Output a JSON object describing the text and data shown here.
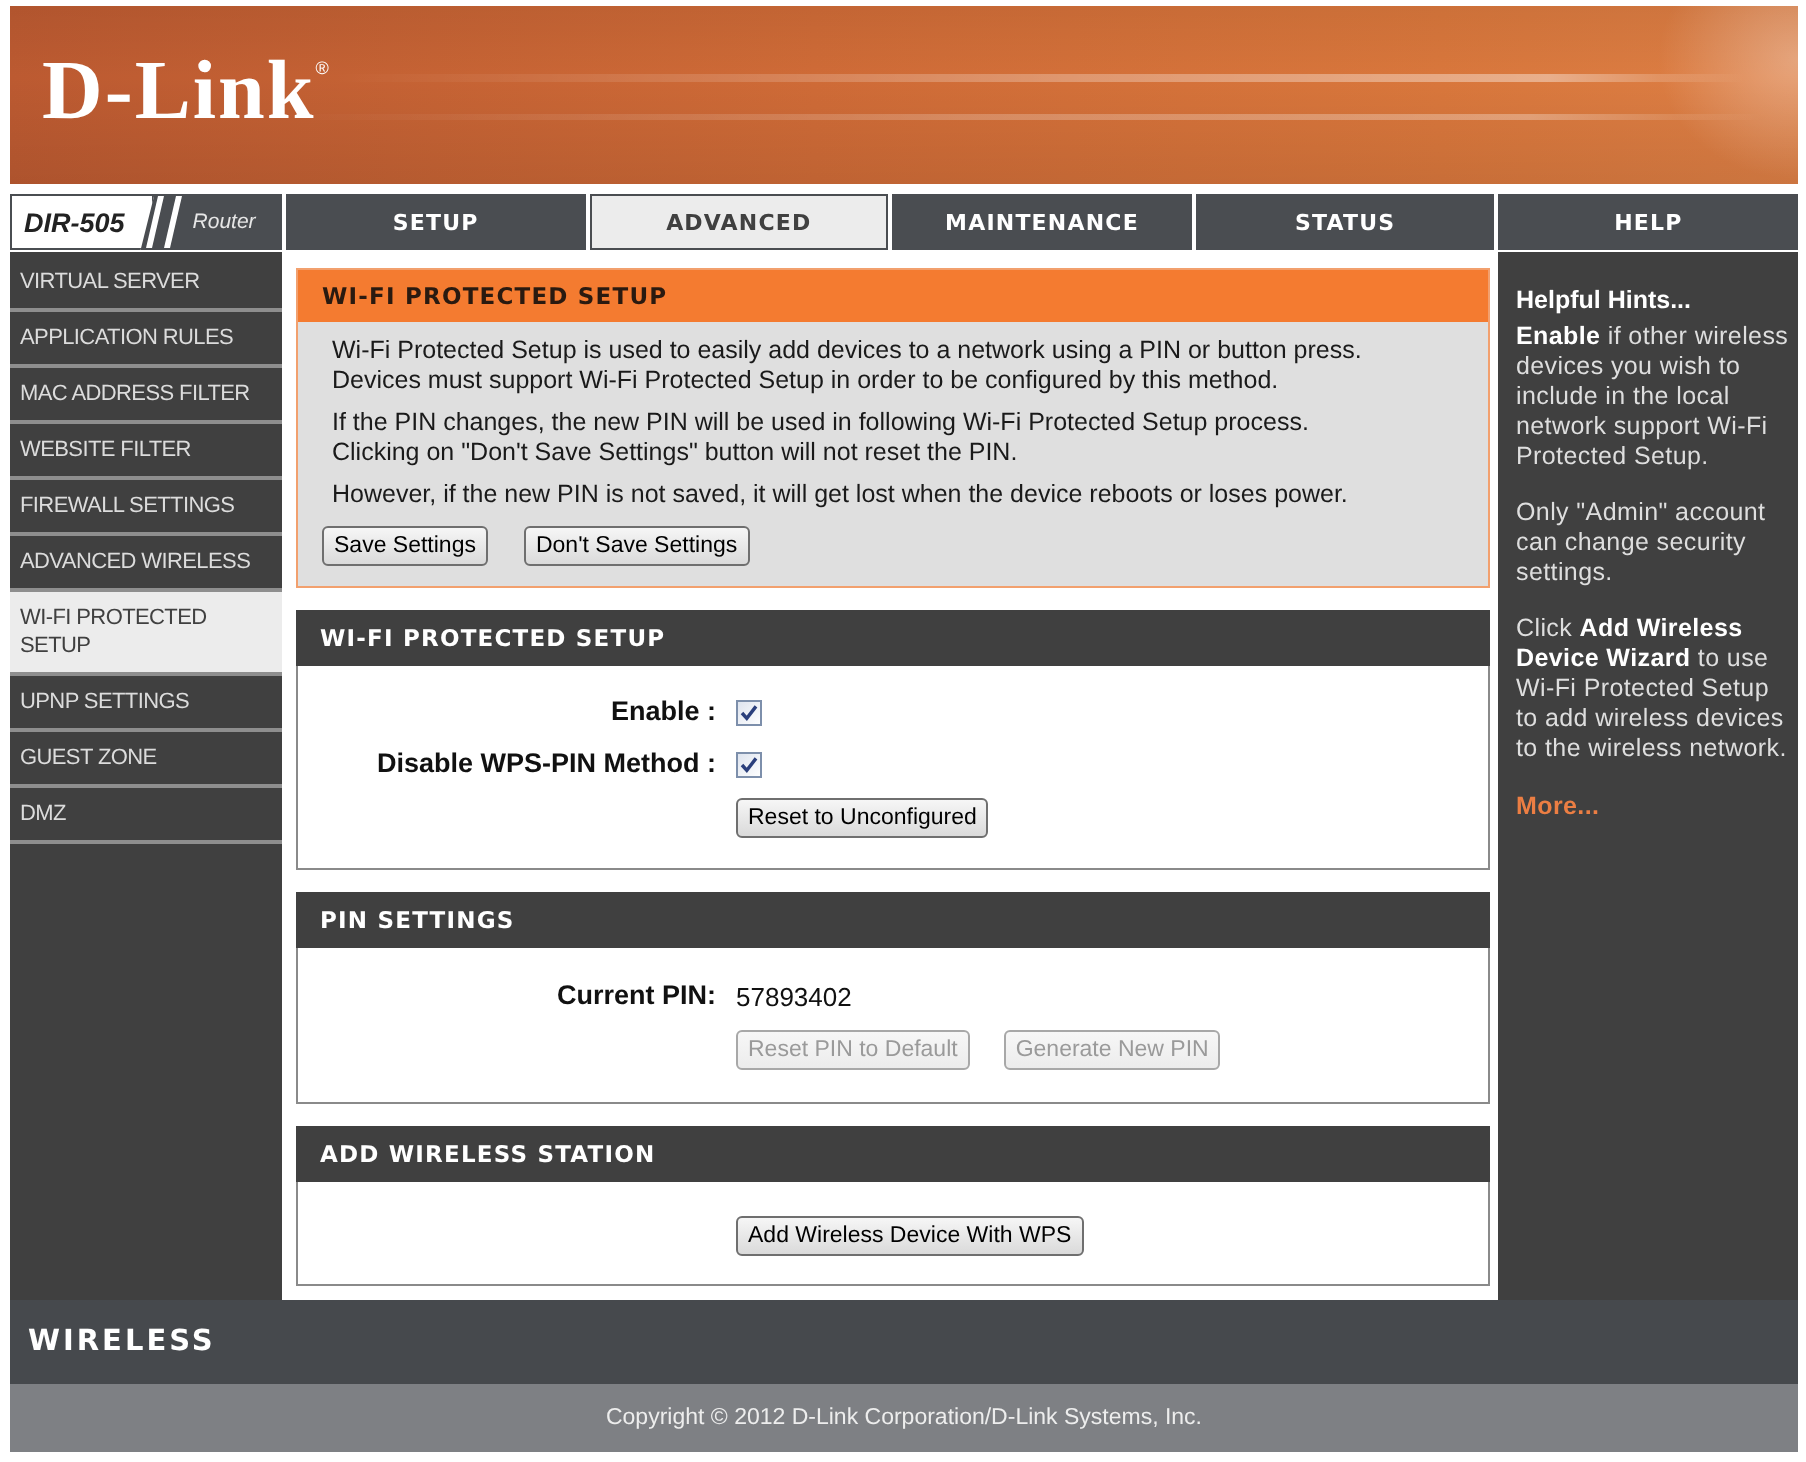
{
  "header": {
    "logo": "D-Link$^{®}$"
  },
  "nav": {
    "model": "DIR-505",
    "model_type": "Router",
    "tabs": [
      {
        "label": "SETUP",
        "selected": false
      },
      {
        "label": "ADVANCED",
        "selected": true
      },
      {
        "label": "MAINTENANCE",
        "selected": false
      },
      {
        "label": "STATUS",
        "selected": false
      },
      {
        "label": "HELP",
        "selected": false
      }
    ]
  },
  "sidebar": {
    "items": [
      {
        "label": "VIRTUAL SERVER",
        "selected": false
      },
      {
        "label": "APPLICATION RULES",
        "selected": false
      },
      {
        "label": "MAC ADDRESS FILTER",
        "selected": false
      },
      {
        "label": "WEBSITE FILTER",
        "selected": false
      },
      {
        "label": "FIREWALL SETTINGS",
        "selected": false
      },
      {
        "label": "ADVANCED WIRELESS",
        "selected": false
      },
      {
        "label": "WI-FI PROTECTED SETUP",
        "selected": true
      },
      {
        "label": "UPNP SETTINGS",
        "selected": false
      },
      {
        "label": "GUEST ZONE",
        "selected": false
      },
      {
        "label": "DMZ",
        "selected": false
      }
    ]
  },
  "main": {
    "intro": {
      "title": "WI-FI PROTECTED SETUP",
      "paragraphs": [
        [
          "Wi-Fi Protected Setup is used to easily add devices to a network using a PIN or button press.",
          "Devices must support Wi-Fi Protected Setup in order to be configured by this method."
        ],
        [
          "If the PIN changes, the new PIN will be used in following Wi-Fi Protected Setup process.",
          "Clicking on \"Don't Save Settings\" button will not reset the PIN."
        ],
        [
          "However, if the new PIN is not saved, it will get lost when the device reboots or loses power."
        ]
      ],
      "buttons": [
        {
          "label": "Save Settings",
          "disabled": false
        },
        {
          "label": "Don't Save Settings",
          "disabled": false
        }
      ]
    },
    "wps": {
      "title": "WI-FI PROTECTED SETUP",
      "fields": [
        {
          "label": "Enable :",
          "checked": true
        },
        {
          "label": "Disable WPS-PIN Method :",
          "checked": true
        }
      ],
      "button": {
        "label": "Reset to Unconfigured",
        "disabled": false
      }
    },
    "pin": {
      "title": "PIN SETTINGS",
      "label": "Current PIN:",
      "value": "57893402",
      "buttons": [
        {
          "label": "Reset PIN to Default",
          "disabled": true
        },
        {
          "label": "Generate New PIN",
          "disabled": true
        }
      ]
    },
    "station": {
      "title": "ADD WIRELESS STATION",
      "button": {
        "label": "Add Wireless Device With WPS",
        "disabled": false
      }
    }
  },
  "help": {
    "title": "Helpful Hints...",
    "paragraphs": [
      "**Enable** if other wireless devices you wish to include in the local network support Wi-Fi Protected Setup.",
      "Only \"Admin\" account can change security settings.",
      "Click **Add Wireless Device Wizard** to use Wi-Fi Protected Setup to add wireless devices to the wireless network."
    ],
    "more": "More..."
  },
  "footer": {
    "brand": "WIRELESS",
    "copyright": "Copyright © 2012 D-Link Corporation/D-Link Systems, Inc."
  }
}
